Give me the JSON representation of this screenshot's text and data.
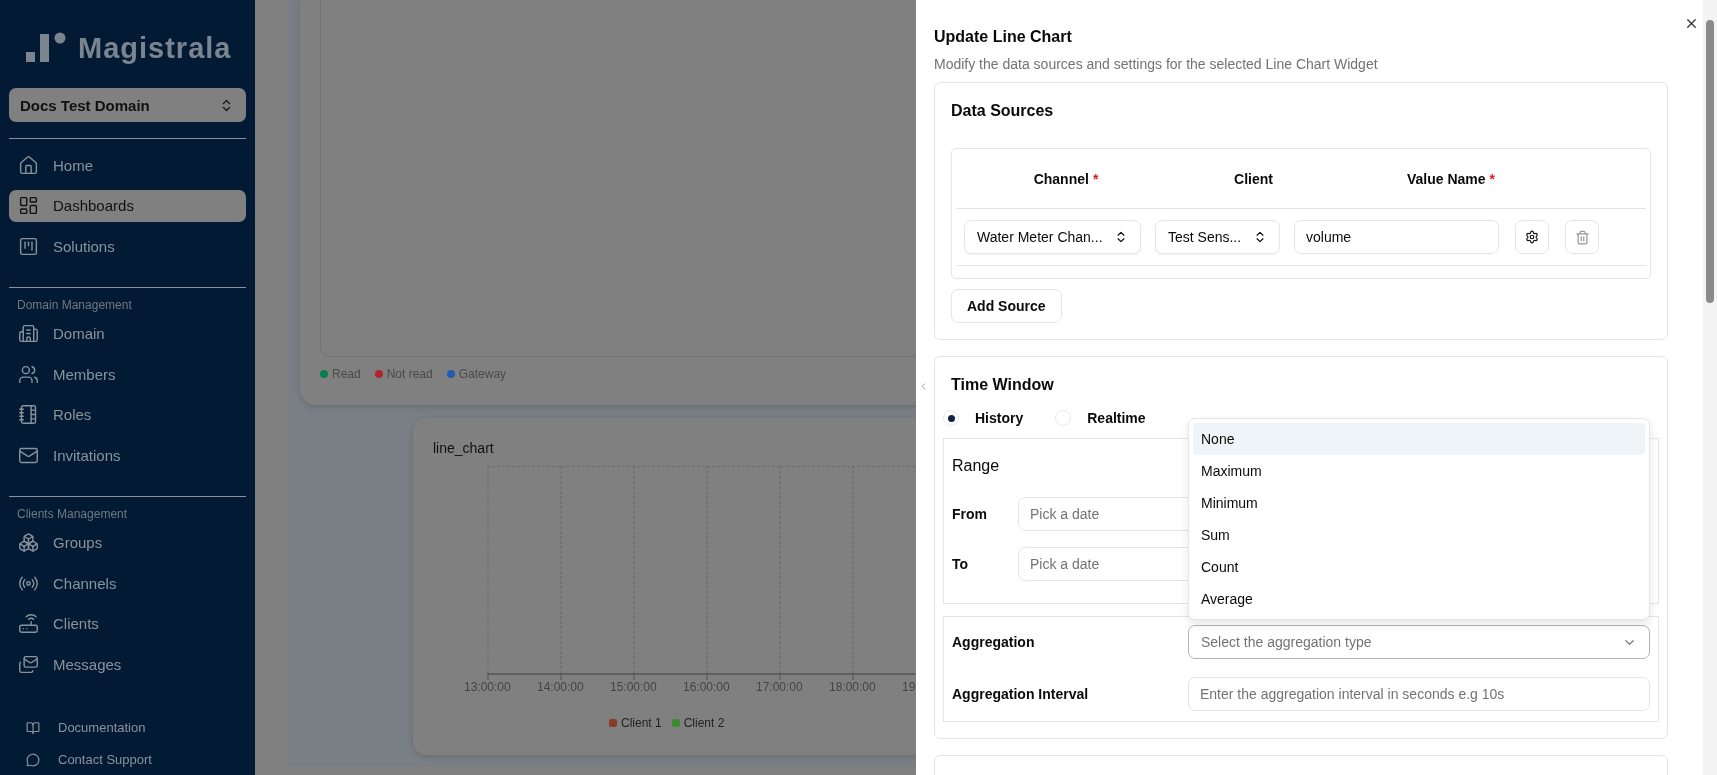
{
  "sidebar": {
    "logo": "Magistrala",
    "domain_select": "Docs Test Domain",
    "sections": [
      {
        "items": [
          {
            "label": "Home",
            "selected": false
          },
          {
            "label": "Dashboards",
            "selected": true
          },
          {
            "label": "Solutions",
            "selected": false
          }
        ]
      },
      {
        "heading": "Domain Management",
        "items": [
          {
            "label": "Domain",
            "selected": false
          },
          {
            "label": "Members",
            "selected": false
          },
          {
            "label": "Roles",
            "selected": false
          },
          {
            "label": "Invitations",
            "selected": false
          }
        ]
      },
      {
        "heading": "Clients Management",
        "items": [
          {
            "label": "Groups",
            "selected": false
          },
          {
            "label": "Channels",
            "selected": false
          },
          {
            "label": "Clients",
            "selected": false
          },
          {
            "label": "Messages",
            "selected": false
          }
        ]
      }
    ],
    "footer_links": [
      {
        "label": "Documentation"
      },
      {
        "label": "Contact Support"
      }
    ]
  },
  "dashboard": {
    "legend": [
      {
        "label": "Read",
        "color": "#067f4f"
      },
      {
        "label": "Not read",
        "color": "#b0222c"
      },
      {
        "label": "Gateway",
        "color": "#2459b5"
      }
    ],
    "line_chart": {
      "title": "line_chart",
      "x_ticks": [
        "13:00:00",
        "14:00:00",
        "15:00:00",
        "16:00:00",
        "17:00:00",
        "18:00:00",
        "19"
      ],
      "legend": [
        {
          "label": "Client 1",
          "color": "#8b3b2b"
        },
        {
          "label": "Client 2",
          "color": "#3d8a2f"
        }
      ]
    }
  },
  "panel": {
    "title": "Update Line Chart",
    "subtitle": "Modify the data sources and settings for the selected Line Chart Widget",
    "data_sources": {
      "heading": "Data Sources",
      "columns": [
        {
          "label": "Channel",
          "mark": "*"
        },
        {
          "label": "Client"
        },
        {
          "label": "Value Name",
          "mark": "*"
        }
      ],
      "rows": [
        {
          "channel": "Water Meter Chan...",
          "client": "Test Sens...",
          "value_name": "volume"
        }
      ],
      "add_button": "Add Source"
    },
    "time_window": {
      "heading": "Time Window",
      "modes": [
        {
          "label": "History",
          "selected": true
        },
        {
          "label": "Realtime",
          "selected": false
        }
      ],
      "range": {
        "heading": "Range",
        "fields": [
          {
            "label": "From",
            "placeholder": "Pick a date"
          },
          {
            "label": "To",
            "placeholder": "Pick a date"
          }
        ]
      },
      "aggregation": {
        "label": "Aggregation",
        "placeholder": "Select the aggregation type",
        "expanded": true,
        "options": [
          {
            "label": "None",
            "selected": true
          },
          {
            "label": "Maximum",
            "selected": false
          },
          {
            "label": "Minimum",
            "selected": false
          },
          {
            "label": "Sum",
            "selected": false
          },
          {
            "label": "Count",
            "selected": false
          },
          {
            "label": "Average",
            "selected": false
          }
        ]
      },
      "interval": {
        "label": "Aggregation Interval",
        "placeholder": "Enter the aggregation interval in seconds e.g 10s"
      }
    }
  }
}
